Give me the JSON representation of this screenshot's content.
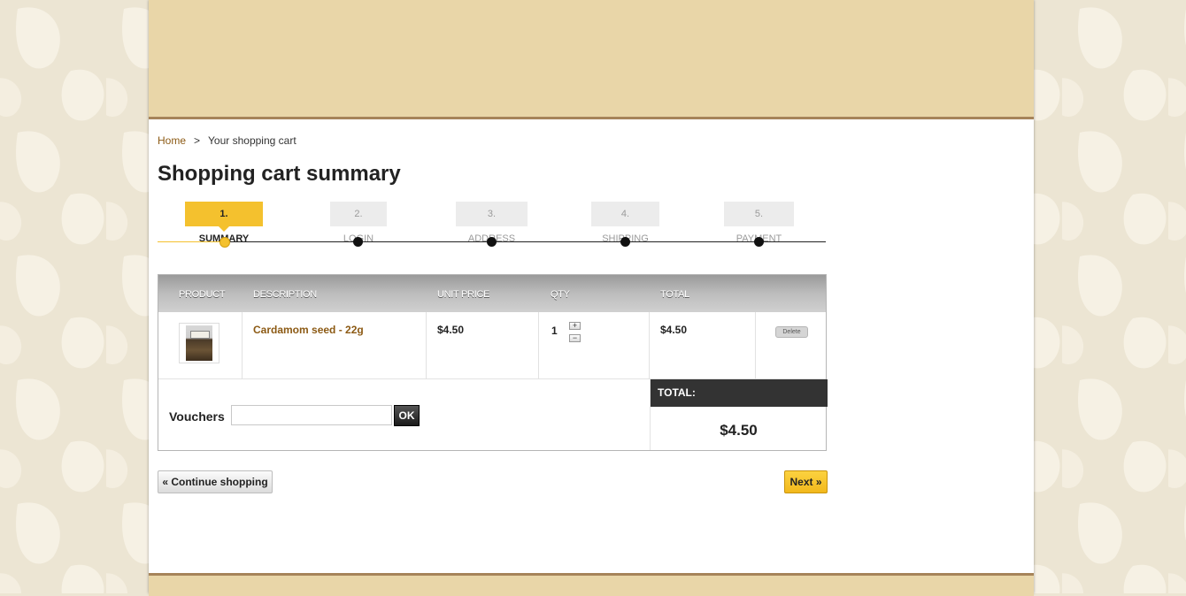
{
  "breadcrumb": {
    "home": "Home",
    "separator": ">",
    "current": "Your shopping cart"
  },
  "page_title": "Shopping cart summary",
  "steps": [
    {
      "label": "1. Summary",
      "active": true
    },
    {
      "label": "2. Login",
      "active": false
    },
    {
      "label": "3. Address",
      "active": false
    },
    {
      "label": "4. Shipping",
      "active": false
    },
    {
      "label": "5. Payment",
      "active": false
    }
  ],
  "cart": {
    "columns": {
      "product": "Product",
      "description": "Description",
      "unit_price": "Unit price",
      "qty": "Qty",
      "total": "Total"
    },
    "items": [
      {
        "name": "Cardamom seed - 22g",
        "unit_price": "$4.50",
        "qty": "1",
        "total": "$4.50",
        "increase": "+",
        "decrease": "−",
        "delete": "Delete"
      }
    ],
    "vouchers": {
      "label": "Vouchers",
      "value": "",
      "button": "OK"
    },
    "total_label": "TOTAL:",
    "total_value": "$4.50"
  },
  "actions": {
    "continue": "« Continue shopping",
    "next": "Next »"
  },
  "colors": {
    "accent": "#f4c12e",
    "brand_link": "#8c5a14",
    "header_bg": "#e9d6a8",
    "page_bg": "#ece5d3"
  }
}
